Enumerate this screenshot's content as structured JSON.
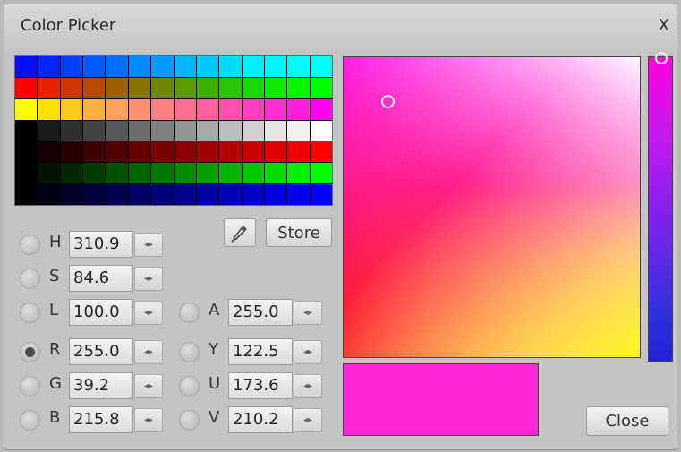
{
  "window": {
    "title": "Color Picker",
    "close_glyph": "X"
  },
  "palette": {
    "rows": [
      [
        "#0010ff",
        "#0027ff",
        "#0040ff",
        "#0058ff",
        "#0070ff",
        "#0088ff",
        "#009cff",
        "#00b4ff",
        "#00c8ff",
        "#00dcff",
        "#00eeff",
        "#00f6ff",
        "#00fcff",
        "#00ffff"
      ],
      [
        "#ff0000",
        "#e82100",
        "#d03800",
        "#b84a00",
        "#a06000",
        "#887400",
        "#708800",
        "#589c00",
        "#40b000",
        "#2cc400",
        "#18d800",
        "#10e800",
        "#08f400",
        "#00ff00"
      ],
      [
        "#ffff00",
        "#ffe000",
        "#ffc820",
        "#ffb040",
        "#ffa060",
        "#ff9070",
        "#ff8080",
        "#ff7090",
        "#ff60a0",
        "#ff50b0",
        "#ff40c0",
        "#ff30d0",
        "#ff20e0",
        "#ff00f0"
      ],
      [
        "#000000",
        "#1a1a1a",
        "#303030",
        "#444444",
        "#585858",
        "#6c6c6c",
        "#808080",
        "#949494",
        "#a8a8a8",
        "#bcbcbc",
        "#d0d0d0",
        "#e4e4e4",
        "#f0f0f0",
        "#ffffff"
      ],
      [
        "#000000",
        "#140000",
        "#280000",
        "#3c0000",
        "#500000",
        "#640000",
        "#780000",
        "#8c0000",
        "#a00000",
        "#b40000",
        "#c80000",
        "#dc0000",
        "#f00000",
        "#ff0000"
      ],
      [
        "#000000",
        "#001400",
        "#002800",
        "#003c00",
        "#005000",
        "#006400",
        "#007800",
        "#008c00",
        "#00a000",
        "#00b400",
        "#00c800",
        "#00dc00",
        "#00f000",
        "#00ff00"
      ],
      [
        "#000000",
        "#000014",
        "#000028",
        "#00003c",
        "#000050",
        "#000064",
        "#000078",
        "#00008c",
        "#0000a0",
        "#0000b4",
        "#0000c8",
        "#0000dc",
        "#0000f0",
        "#0000ff"
      ]
    ]
  },
  "icons": {
    "eyedropper": "eyedropper-icon",
    "spin": "◂▸"
  },
  "buttons": {
    "store": "Store",
    "close": "Close"
  },
  "fields": {
    "H": {
      "label": "H",
      "value": "310.9",
      "checked": false
    },
    "S": {
      "label": "S",
      "value": "84.6",
      "checked": false
    },
    "L": {
      "label": "L",
      "value": "100.0",
      "checked": false
    },
    "A": {
      "label": "A",
      "value": "255.0",
      "checked": false
    },
    "R": {
      "label": "R",
      "value": "255.0",
      "checked": true
    },
    "G": {
      "label": "G",
      "value": "39.2",
      "checked": false
    },
    "B": {
      "label": "B",
      "value": "215.8",
      "checked": false
    },
    "Y": {
      "label": "Y",
      "value": "122.5",
      "checked": false
    },
    "U": {
      "label": "U",
      "value": "173.6",
      "checked": false
    },
    "V": {
      "label": "V",
      "value": "210.2",
      "checked": false
    }
  },
  "colors": {
    "current": "#ff27d8",
    "hue": "#ff00e0"
  }
}
